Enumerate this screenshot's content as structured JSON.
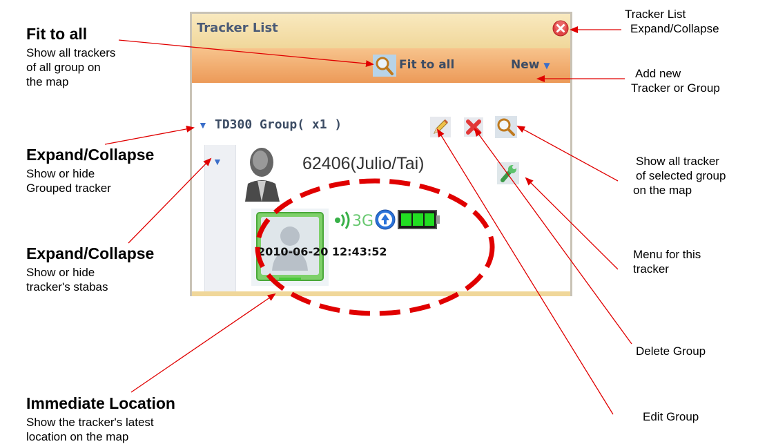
{
  "panel": {
    "title": "Tracker List",
    "fit_label": "Fit to all",
    "new_label": "New",
    "group_label": "TD300 Group( x1 )",
    "tracker_name": "62406(Julio/Tai)",
    "tracker_signal": "3G",
    "tracker_time": "2010-06-20 12:43:52"
  },
  "annotations": {
    "fit_title": "Fit to all",
    "fit_desc": [
      "Show all trackers",
      "of all group on",
      "the map"
    ],
    "expand_group_title": "Expand/Collapse",
    "expand_group_desc": [
      "Show or hide",
      "Grouped tracker"
    ],
    "expand_tracker_title": "Expand/Collapse",
    "expand_tracker_desc": [
      "Show or hide",
      "tracker's stabas"
    ],
    "immediate_title": "Immediate Location",
    "immediate_desc": [
      "Show the tracker's latest",
      "location on the map"
    ],
    "tracker_list_toggle": [
      "Tracker List",
      "Expand/Collapse"
    ],
    "add_new": [
      "Add new",
      "Tracker or Group"
    ],
    "show_group": [
      "Show all tracker",
      "of selected group",
      "on the map"
    ],
    "menu": [
      "Menu for this",
      "tracker"
    ],
    "delete_group": "Delete Group",
    "edit_group": "Edit Group"
  },
  "colors": {
    "arrow": "#e00000",
    "title_text": "#4a5a76",
    "toolbar": "#ec9a58",
    "titlebar": "#f0d79a",
    "battery": "#22cc22"
  },
  "icons": [
    "close-icon",
    "search-icon",
    "pencil-icon",
    "delete-icon",
    "wrench-icon",
    "user-avatar-icon",
    "person-photo-icon",
    "signal-icon",
    "gps-icon",
    "battery-icon",
    "triangle-down-icon"
  ]
}
